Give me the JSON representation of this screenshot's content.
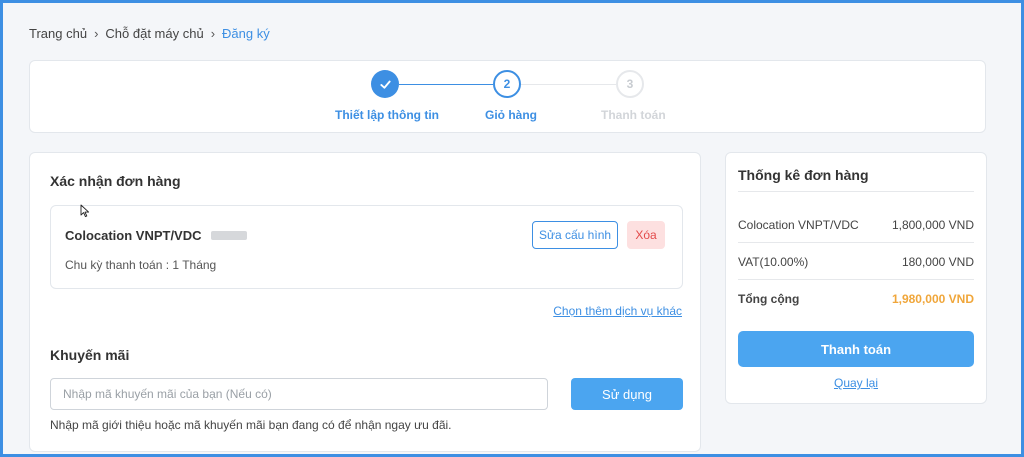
{
  "breadcrumb": {
    "items": [
      "Trang chủ",
      "Chỗ đặt máy chủ"
    ],
    "current": "Đăng ký"
  },
  "stepper": {
    "steps": [
      {
        "number": "1",
        "label": "Thiết lập thông tin",
        "state": "done"
      },
      {
        "number": "2",
        "label": "Giỏ hàng",
        "state": "active"
      },
      {
        "number": "3",
        "label": "Thanh toán",
        "state": "pending"
      }
    ]
  },
  "order": {
    "title": "Xác nhận đơn hàng",
    "item_name": "Colocation VNPT/VDC",
    "cycle": "Chu kỳ thanh toán : 1 Tháng",
    "edit_label": "Sửa cấu hình",
    "delete_label": "Xóa",
    "more_link": "Chọn thêm dịch vụ khác"
  },
  "promo": {
    "title": "Khuyến mãi",
    "placeholder": "Nhập mã khuyến mãi của bạn (Nếu có)",
    "apply_label": "Sử dụng",
    "hint": "Nhập mã giới thiệu hoặc mã khuyến mãi bạn đang có để nhận ngay ưu đãi."
  },
  "summary": {
    "title": "Thống kê đơn hàng",
    "rows": [
      {
        "label": "Colocation VNPT/VDC",
        "value": "1,800,000 VND"
      },
      {
        "label": "VAT(10.00%)",
        "value": "180,000 VND"
      },
      {
        "label": "Tổng cộng",
        "value": "1,980,000 VND"
      }
    ],
    "pay_label": "Thanh toán",
    "back_label": "Quay lại"
  },
  "colors": {
    "accent": "#3d8fe3",
    "button": "#4ba5f0",
    "total": "#f0a63a",
    "delete_bg": "#fde0e0",
    "delete_text": "#e34a4a"
  },
  "icons": {
    "step_done": "check-icon",
    "breadcrumb_separator": "chevron-right-icon",
    "cursor": "mouse-cursor-icon"
  }
}
